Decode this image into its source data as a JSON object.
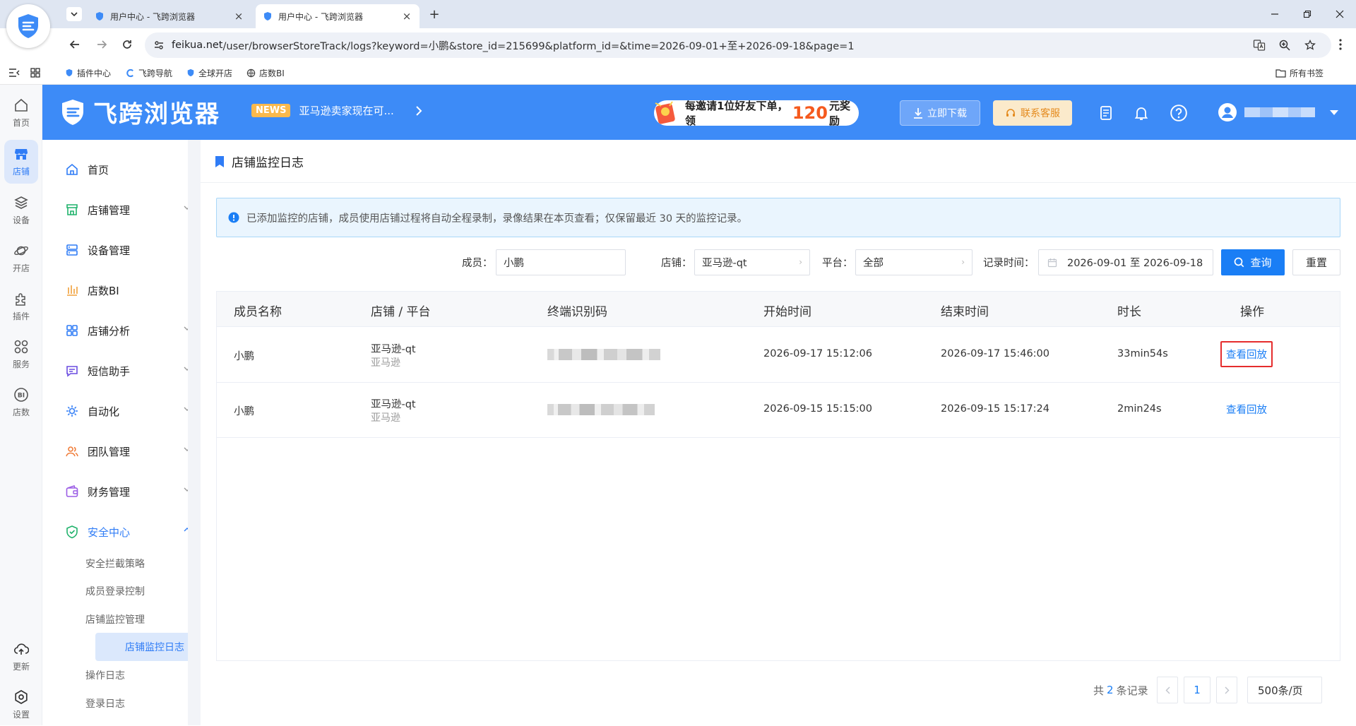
{
  "browser": {
    "tabs": [
      {
        "label": "用户中心 - 飞跨浏览器",
        "active": false
      },
      {
        "label": "用户中心 - 飞跨浏览器",
        "active": true
      }
    ],
    "url_host": "feikua.net",
    "url_path": "/user/browserStoreTrack/logs?keyword=小鹏&store_id=215699&platform_id=&time=2026-09-01+至+2026-09-18&page=1",
    "bookmarks": [
      "插件中心",
      "飞跨导航",
      "全球开店",
      "店数BI"
    ],
    "all_bookmarks": "所有书签"
  },
  "rail": {
    "items": [
      {
        "label": "首页",
        "icon": "home-icon"
      },
      {
        "label": "店铺",
        "icon": "store-icon"
      },
      {
        "label": "设备",
        "icon": "layers-icon"
      },
      {
        "label": "开店",
        "icon": "planet-icon"
      },
      {
        "label": "插件",
        "icon": "puzzle-icon"
      },
      {
        "label": "服务",
        "icon": "grid-icon"
      },
      {
        "label": "店数",
        "icon": "bi-icon"
      }
    ],
    "bottom": [
      {
        "label": "更新",
        "icon": "cloud-upload-icon"
      },
      {
        "label": "设置",
        "icon": "settings-icon"
      }
    ]
  },
  "header": {
    "brand": "飞跨浏览器",
    "news_badge": "NEWS",
    "news_text": "亚马逊卖家现在可...",
    "promo_pre": "每邀请1位好友下单，领",
    "promo_num": "120",
    "promo_post": "元奖励",
    "download": "立即下载",
    "contact": "联系客服"
  },
  "sidebar": {
    "items": [
      {
        "label": "首页",
        "expandable": false
      },
      {
        "label": "店铺管理",
        "expandable": true
      },
      {
        "label": "设备管理",
        "expandable": false
      },
      {
        "label": "店数BI",
        "expandable": false
      },
      {
        "label": "店铺分析",
        "expandable": true
      },
      {
        "label": "短信助手",
        "expandable": true
      },
      {
        "label": "自动化",
        "expandable": true
      },
      {
        "label": "团队管理",
        "expandable": true
      },
      {
        "label": "财务管理",
        "expandable": true
      },
      {
        "label": "安全中心",
        "expandable": true,
        "expanded": true
      }
    ],
    "subitems": [
      "安全拦截策略",
      "成员登录控制",
      "店铺监控管理",
      "店铺监控日志",
      "操作日志",
      "登录日志"
    ],
    "active_sub": "店铺监控日志"
  },
  "main": {
    "title": "店铺监控日志",
    "notice": "已添加监控的店铺，成员使用店铺过程将自动全程录制，录像结果在本页查看；仅保留最近 30 天的监控记录。",
    "filters": {
      "member_label": "成员：",
      "member_value": "小鹏",
      "store_label": "店铺：",
      "store_value": "亚马逊-qt",
      "platform_label": "平台：",
      "platform_value": "全部",
      "time_label": "记录时间：",
      "time_value": "2026-09-01 至 2026-09-18",
      "query": "查询",
      "reset": "重置"
    },
    "columns": [
      "成员名称",
      "店铺 / 平台",
      "终端识别码",
      "开始时间",
      "结束时间",
      "时长",
      "操作"
    ],
    "rows": [
      {
        "member": "小鹏",
        "store": "亚马逊-qt",
        "platform": "亚马逊",
        "start": "2026-09-17 15:12:06",
        "end": "2026-09-17 15:46:00",
        "duration": "33min54s",
        "action": "查看回放"
      },
      {
        "member": "小鹏",
        "store": "亚马逊-qt",
        "platform": "亚马逊",
        "start": "2026-09-15 15:15:00",
        "end": "2026-09-15 15:17:24",
        "duration": "2min24s",
        "action": "查看回放"
      }
    ],
    "pager": {
      "total_pre": "共",
      "total": "2",
      "total_post": "条记录",
      "current_page": "1",
      "page_size": "500条/页"
    }
  },
  "colors": {
    "brand_blue": "#3d8bf7",
    "link_blue": "#1a7ef5",
    "highlight_red": "#e52d2d"
  }
}
